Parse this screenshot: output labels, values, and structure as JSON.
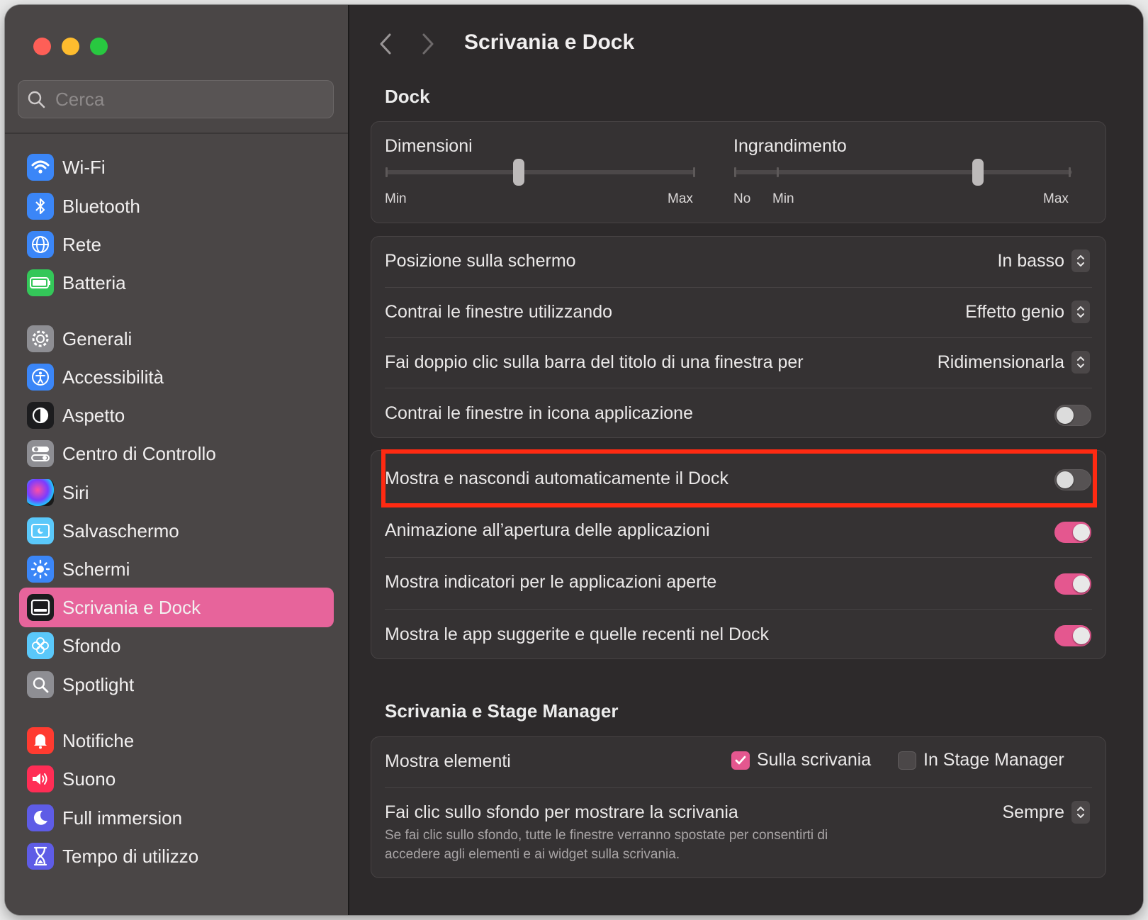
{
  "window": {
    "title": "Scrivania e Dock"
  },
  "sidebar": {
    "search_placeholder": "Cerca",
    "items": [
      {
        "label": "Wi-Fi",
        "icon": "wifi-icon",
        "color": "#3b86f7"
      },
      {
        "label": "Bluetooth",
        "icon": "bluetooth-icon",
        "color": "#3b86f7"
      },
      {
        "label": "Rete",
        "icon": "globe-icon",
        "color": "#3b86f7"
      },
      {
        "label": "Batteria",
        "icon": "battery-icon",
        "color": "#34c759"
      },
      {
        "label": "Generali",
        "icon": "gear-icon",
        "color": "#8e8e93"
      },
      {
        "label": "Accessibilità",
        "icon": "accessibility-icon",
        "color": "#3b86f7"
      },
      {
        "label": "Aspetto",
        "icon": "appearance-icon",
        "color": "#1c1c1e"
      },
      {
        "label": "Centro di Controllo",
        "icon": "control-center-icon",
        "color": "#8e8e93"
      },
      {
        "label": "Siri",
        "icon": "siri-icon",
        "color": "#2b2b2b"
      },
      {
        "label": "Salvaschermo",
        "icon": "screensaver-icon",
        "color": "#5ac8fa"
      },
      {
        "label": "Schermi",
        "icon": "sun-icon",
        "color": "#3b86f7"
      },
      {
        "label": "Scrivania e Dock",
        "icon": "dock-icon",
        "color": "#1c1c1e"
      },
      {
        "label": "Sfondo",
        "icon": "flower-icon",
        "color": "#5ac8fa"
      },
      {
        "label": "Spotlight",
        "icon": "magnifier-icon",
        "color": "#8e8e93"
      },
      {
        "label": "Notifiche",
        "icon": "bell-icon",
        "color": "#ff3b30"
      },
      {
        "label": "Suono",
        "icon": "speaker-icon",
        "color": "#ff2d55"
      },
      {
        "label": "Full immersion",
        "icon": "moon-icon",
        "color": "#5e5ce6"
      },
      {
        "label": "Tempo di utilizzo",
        "icon": "hourglass-icon",
        "color": "#5e5ce6"
      }
    ]
  },
  "header": {
    "title": "Scrivania e Dock"
  },
  "dock": {
    "section_title": "Dock",
    "size": {
      "label": "Dimensioni",
      "min": "Min",
      "max": "Max",
      "value": 0.43
    },
    "magnification": {
      "label": "Ingrandimento",
      "no": "No",
      "min": "Min",
      "max": "Max",
      "value": 0.72
    },
    "position": {
      "label": "Posizione sulla schermo",
      "value": "In basso"
    },
    "minimize": {
      "label": "Contrai le finestre utilizzando",
      "value": "Effetto genio"
    },
    "double_click": {
      "label": "Fai doppio clic sulla barra del titolo di una finestra per",
      "value": "Ridimensionarla"
    },
    "minimize_to_icon": {
      "label": "Contrai le finestre in icona applicazione",
      "on": false
    },
    "autohide": {
      "label": "Mostra e nascondi automaticamente il Dock",
      "on": false
    },
    "animate": {
      "label": "Animazione all’apertura delle applicazioni",
      "on": true
    },
    "indicators": {
      "label": "Mostra indicatori per le applicazioni aperte",
      "on": true
    },
    "recents": {
      "label": "Mostra le app suggerite e quelle recenti nel Dock",
      "on": true
    }
  },
  "stage": {
    "section_title": "Scrivania e Stage Manager",
    "show_items": {
      "label": "Mostra elementi",
      "desktop": "Sulla scrivania",
      "stage": "In Stage Manager"
    },
    "click_wallpaper": {
      "label": "Fai clic sullo sfondo per mostrare la scrivania",
      "value": "Sempre",
      "desc1": "Se fai clic sullo sfondo, tutte le finestre verranno spostate per consentirti di",
      "desc2": "accedere agli elementi e ai widget sulla scrivania."
    }
  },
  "colors": {
    "accent": "#e4578f",
    "highlight": "#ff2a12"
  }
}
